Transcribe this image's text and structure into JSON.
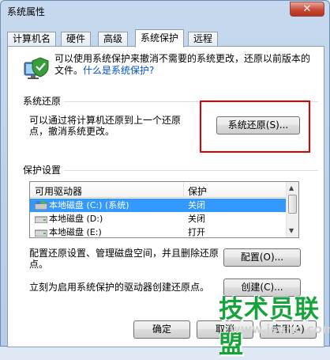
{
  "window": {
    "title": "系统属性",
    "close_glyph": "✕"
  },
  "tabs": [
    {
      "label": "计算机名"
    },
    {
      "label": "硬件"
    },
    {
      "label": "高级"
    },
    {
      "label": "系统保护",
      "active": true
    },
    {
      "label": "远程"
    }
  ],
  "intro": {
    "text": "可以使用系统保护来撤消不需要的系统更改，还原以前版本的文件。",
    "link": "什么是系统保护?"
  },
  "system_restore": {
    "group_label": "系统还原",
    "description": "可以通过将计算机还原到上一个还原点，撤消系统更改。",
    "button": "系统还原(S)..."
  },
  "protection": {
    "group_label": "保护设置",
    "columns": [
      "可用驱动器",
      "保护"
    ],
    "rows": [
      {
        "drive": "本地磁盘 (C:) (系统)",
        "status": "关闭",
        "selected": true
      },
      {
        "drive": "本地磁盘 (D:)",
        "status": "关闭",
        "selected": false
      },
      {
        "drive": "本地磁盘 (E:)",
        "status": "打开",
        "selected": false
      }
    ],
    "config_desc": "配置还原设置、管理磁盘空间，并且删除还原点。",
    "config_button": "配置(O)...",
    "create_desc": "立刻为启用系统保护的驱动器创建还原点。",
    "create_button": "创建(C)..."
  },
  "footer": {
    "ok": "确定",
    "cancel": "取消",
    "apply": "应用(A)"
  },
  "watermark": {
    "title": "技术员联盟",
    "url": "www.jsgho.com"
  },
  "colors": {
    "highlight_box": "#e00000",
    "selected_row": "#3399ff",
    "watermark_green": "#15a33a"
  }
}
